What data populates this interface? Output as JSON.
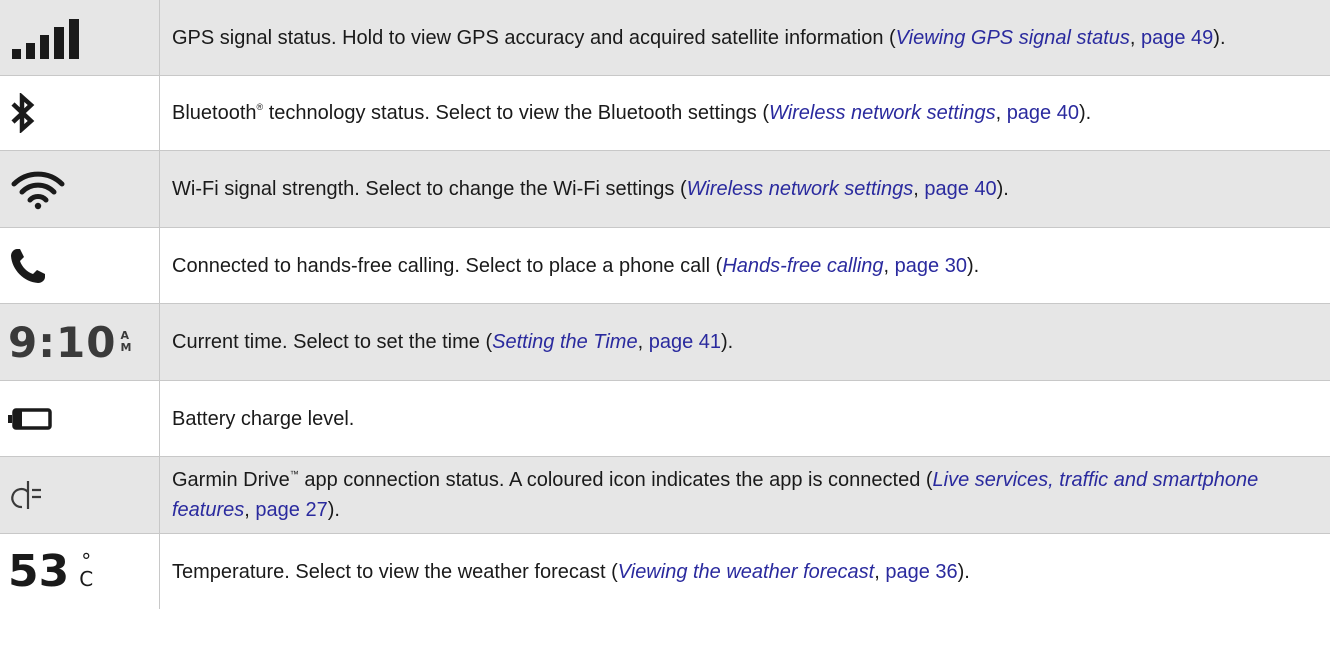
{
  "rows": [
    {
      "icon": "signal-bars-icon",
      "text": "GPS signal status. Hold to view GPS accuracy and acquired satellite information (",
      "link": "Viewing GPS signal status",
      "page": "page 49",
      "end": ")."
    },
    {
      "icon": "bluetooth-icon",
      "text_a": "Bluetooth",
      "sup": "®",
      "text_b": " technology status. Select to view the Bluetooth settings (",
      "link": "Wireless network settings",
      "page": "page 40",
      "end": ")."
    },
    {
      "icon": "wifi-icon",
      "text": "Wi-Fi signal strength. Select to change the Wi-Fi settings (",
      "link": "Wireless network settings",
      "page": "page 40",
      "end": ")."
    },
    {
      "icon": "phone-icon",
      "text": "Connected to hands-free calling. Select to place a phone call (",
      "link": "Hands-free calling",
      "page": "page 30",
      "end": ")."
    },
    {
      "icon": "clock-icon",
      "time": "9:10",
      "ampm_top": "A",
      "ampm_bottom": "M",
      "text": "Current time. Select to set the time (",
      "link": "Setting the Time",
      "page": "page 41",
      "end": ")."
    },
    {
      "icon": "battery-icon",
      "text": "Battery charge level."
    },
    {
      "icon": "garmin-drive-icon",
      "text_a": "Garmin Drive",
      "sup": "™",
      "text_b": " app connection status. A coloured icon indicates the app is connected (",
      "link": "Live services, traffic and smartphone features",
      "page": "page 27",
      "end": ")."
    },
    {
      "icon": "temperature-icon",
      "temp": "53",
      "unit_top": "°",
      "unit_bottom": "C",
      "text": "Temperature. Select to view the weather forecast (",
      "link": "Viewing the weather forecast",
      "page": "page 36",
      "end": ")."
    }
  ]
}
